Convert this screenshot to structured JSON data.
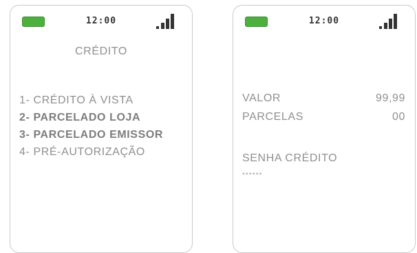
{
  "status_bar": {
    "time": "12:00",
    "battery_icon": "battery-icon",
    "signal_icon": "signal-strength-icon"
  },
  "colors": {
    "battery": "#4caf3e",
    "text": "#8f8f8f",
    "border": "#c9c9c9"
  },
  "left_screen": {
    "title": "CRÉDITO",
    "menu": [
      {
        "label": "1- CRÉDITO À VISTA",
        "bold": false
      },
      {
        "label": "2- PARCELADO LOJA",
        "bold": true
      },
      {
        "label": "3- PARCELADO EMISSOR",
        "bold": true
      },
      {
        "label": "4- PRÉ-AUTORIZAÇÃO",
        "bold": false
      }
    ]
  },
  "right_screen": {
    "valor_label": "VALOR",
    "valor_value": "99,99",
    "parcelas_label": "PARCELAS",
    "parcelas_value": "00",
    "senha_label": "SENHA CRÉDITO",
    "senha_mask": "******"
  }
}
